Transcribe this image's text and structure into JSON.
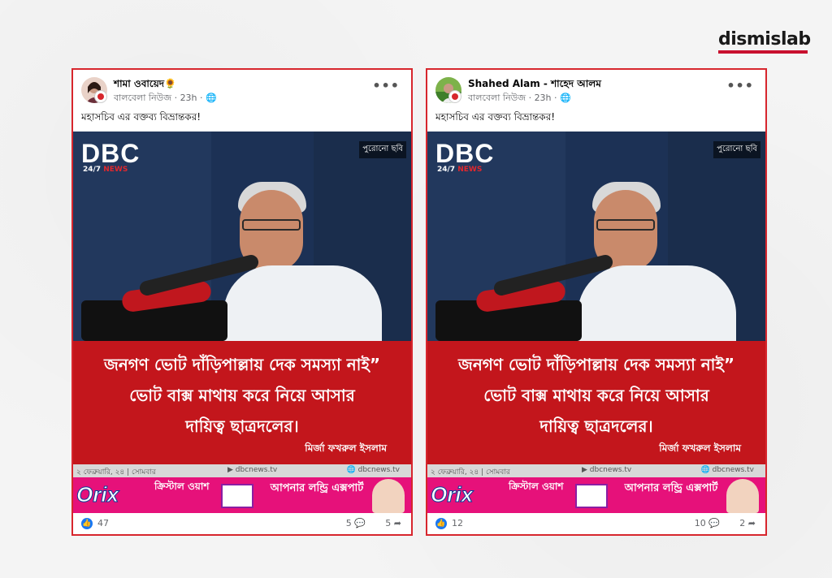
{
  "brand": {
    "name": "dismislab",
    "accent": "#c8102e"
  },
  "posts": [
    {
      "author": "শামা ওবায়েদ",
      "author_emoji": "🌻",
      "page": "বালবেলা নিউজ",
      "time": "23h",
      "caption": "মহাসচিব এর বক্তব্য বিভ্রান্তকর!",
      "image": {
        "channel": "DBC",
        "channel_sub": "24/7",
        "channel_sub2": "NEWS",
        "tag": "পুরোনো ছবি",
        "quote_line1": "জনগণ ভোট দাঁড়িপাল্লায় দেক সমস্যা নাই”",
        "quote_line2": "ভোট বাক্স মাথায় করে নিয়ে আসার",
        "quote_line3": "দায়িত্ব ছাত্রদলের।",
        "signer": "মির্জা ফখরুল ইসলাম",
        "date": "২ ফেব্রুয়ারি, ২৪ | সোমবার",
        "site1": "dbcnews.tv",
        "site2": "dbcnews.tv",
        "ad_brand": "Orix",
        "ad_text1": "ক্রিস্টাল ওয়াশ",
        "ad_text2": "আপনার লন্ড্রি এক্সপার্ট"
      },
      "likes": "47",
      "comments": "5",
      "shares": "5"
    },
    {
      "author": "Shahed Alam - শাহেদ আলম",
      "author_emoji": "",
      "page": "বালবেলা নিউজ",
      "time": "23h",
      "caption": "মহাসচিব এর বক্তব্য বিভ্রান্তকর!",
      "image": {
        "channel": "DBC",
        "channel_sub": "24/7",
        "channel_sub2": "NEWS",
        "tag": "পুরোনো ছবি",
        "quote_line1": "জনগণ ভোট দাঁড়িপাল্লায় দেক সমস্যা নাই”",
        "quote_line2": "ভোট বাক্স মাথায় করে নিয়ে আসার",
        "quote_line3": "দায়িত্ব ছাত্রদলের।",
        "signer": "মির্জা ফখরুল ইসলাম",
        "date": "২ ফেব্রুয়ারি, ২৪ | সোমবার",
        "site1": "dbcnews.tv",
        "site2": "dbcnews.tv",
        "ad_brand": "Orix",
        "ad_text1": "ক্রিস্টাল ওয়াশ",
        "ad_text2": "আপনার লন্ড্রি এক্সপার্ট"
      },
      "likes": "12",
      "comments": "10",
      "shares": "2"
    }
  ]
}
